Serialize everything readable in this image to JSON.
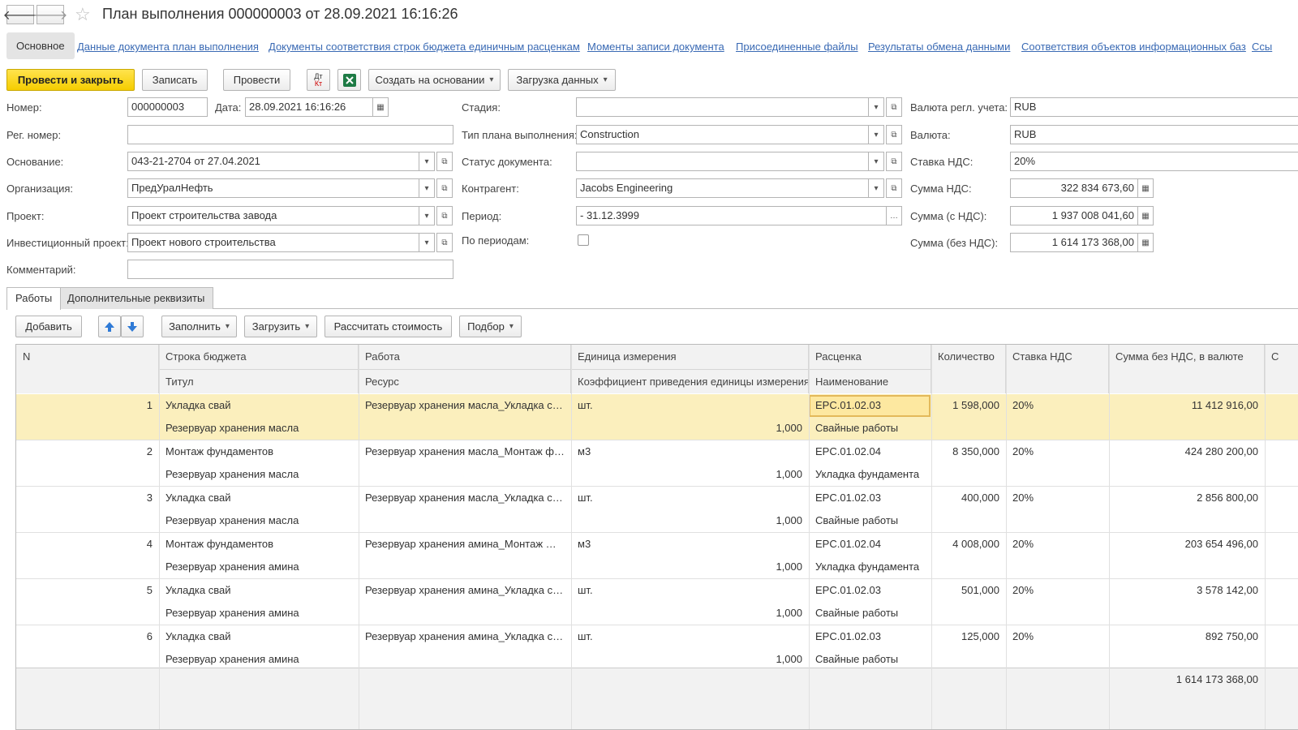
{
  "window": {
    "title": "План выполнения 000000003 от 28.09.2021 16:16:26"
  },
  "sections": {
    "active": "Основное",
    "links": [
      "Данные документа план выполнения",
      "Документы соответствия строк бюджета единичным расценкам",
      "Моменты записи документа",
      "Присоединенные файлы",
      "Результаты обмена данными",
      "Соответствия объектов информационных баз",
      "Ссы"
    ]
  },
  "toolbar": {
    "post_close": "Провести и закрыть",
    "save": "Записать",
    "post": "Провести",
    "dt_kt_top": "Дт",
    "dt_kt_bottom": "Кт",
    "create_based": "Создать на основании",
    "load_data": "Загрузка данных"
  },
  "form": {
    "number_label": "Номер:",
    "number": "000000003",
    "date_label": "Дата:",
    "date": "28.09.2021 16:16:26",
    "reg_number_label": "Рег. номер:",
    "reg_number": "",
    "basis_label": "Основание:",
    "basis": "043-21-2704 от 27.04.2021",
    "org_label": "Организация:",
    "org": "ПредУралНефть",
    "project_label": "Проект:",
    "project": "Проект строительства завода",
    "inv_project_label": "Инвестиционный проект:",
    "inv_project": "Проект нового строительства",
    "comment_label": "Комментарий:",
    "comment": "",
    "stage_label": "Стадия:",
    "stage": "",
    "plan_type_label": "Тип плана выполнения:",
    "plan_type": "Construction",
    "doc_status_label": "Статус документа:",
    "doc_status": "",
    "contractor_label": "Контрагент:",
    "contractor": "Jacobs Engineering",
    "period_label": "Период:",
    "period": "- 31.12.3999",
    "by_periods_label": "По периодам:",
    "reg_currency_label": "Валюта регл. учета:",
    "reg_currency": "RUB",
    "currency_label": "Валюта:",
    "currency": "RUB",
    "vat_rate_label": "Ставка НДС:",
    "vat_rate": "20%",
    "vat_sum_label": "Сумма НДС:",
    "vat_sum": "322 834 673,60",
    "sum_with_vat_label": "Сумма (с НДС):",
    "sum_with_vat": "1 937 008 041,60",
    "sum_without_vat_label": "Сумма (без НДС):",
    "sum_without_vat": "1 614 173 368,00"
  },
  "tabs": [
    "Работы",
    "Дополнительные реквизиты"
  ],
  "table_toolbar": {
    "add": "Добавить",
    "fill": "Заполнить",
    "load": "Загрузить",
    "calc": "Рассчитать стоимость",
    "pick": "Подбор"
  },
  "table": {
    "headers": {
      "n": "N",
      "budget_line": "Строка бюджета",
      "title_sub": "Титул",
      "work": "Работа",
      "resource": "Ресурс",
      "unit": "Единица измерения",
      "coef": "Коэффициент приведения единицы измерения",
      "rate": "Расценка",
      "name": "Наименование",
      "qty": "Количество",
      "vat": "Ставка НДС",
      "sum": "Сумма без НДС, в валюте",
      "extra": "С"
    },
    "rows": [
      {
        "n": "1",
        "budget_line": "Укладка свай",
        "title_sub": "Резервуар хранения масла",
        "work": "Резервуар хранения масла_Укладка св...",
        "unit": "шт.",
        "coef": "1,000",
        "rate": "EPC.01.02.03",
        "name": "Свайные работы",
        "qty": "1 598,000",
        "vat": "20%",
        "sum": "11 412 916,00"
      },
      {
        "n": "2",
        "budget_line": "Монтаж фундаментов",
        "title_sub": "Резервуар хранения масла",
        "work": "Резервуар хранения масла_Монтаж фу...",
        "unit": "м3",
        "coef": "1,000",
        "rate": "EPC.01.02.04",
        "name": "Укладка фундамента",
        "qty": "8 350,000",
        "vat": "20%",
        "sum": "424 280 200,00"
      },
      {
        "n": "3",
        "budget_line": "Укладка свай",
        "title_sub": "Резервуар хранения масла",
        "work": "Резервуар хранения масла_Укладка св...",
        "unit": "шт.",
        "coef": "1,000",
        "rate": "EPC.01.02.03",
        "name": "Свайные работы",
        "qty": "400,000",
        "vat": "20%",
        "sum": "2 856 800,00"
      },
      {
        "n": "4",
        "budget_line": "Монтаж фундаментов",
        "title_sub": "Резервуар хранения амина",
        "work": "Резервуар хранения амина_Монтаж фу...",
        "unit": "м3",
        "coef": "1,000",
        "rate": "EPC.01.02.04",
        "name": "Укладка фундамента",
        "qty": "4 008,000",
        "vat": "20%",
        "sum": "203 654 496,00"
      },
      {
        "n": "5",
        "budget_line": "Укладка свай",
        "title_sub": "Резервуар хранения амина",
        "work": "Резервуар хранения амина_Укладка св...",
        "unit": "шт.",
        "coef": "1,000",
        "rate": "EPC.01.02.03",
        "name": "Свайные работы",
        "qty": "501,000",
        "vat": "20%",
        "sum": "3 578 142,00"
      },
      {
        "n": "6",
        "budget_line": "Укладка свай",
        "title_sub": "Резервуар хранения амина",
        "work": "Резервуар хранения амина_Укладка св...",
        "unit": "шт.",
        "coef": "1,000",
        "rate": "EPC.01.02.03",
        "name": "Свайные работы",
        "qty": "125,000",
        "vat": "20%",
        "sum": "892 750,00"
      }
    ],
    "total_sum": "1 614 173 368,00"
  },
  "colors": {
    "primary_button": "#f5cd00",
    "link": "#3a6ab4",
    "selected_row": "#fbefbd"
  }
}
